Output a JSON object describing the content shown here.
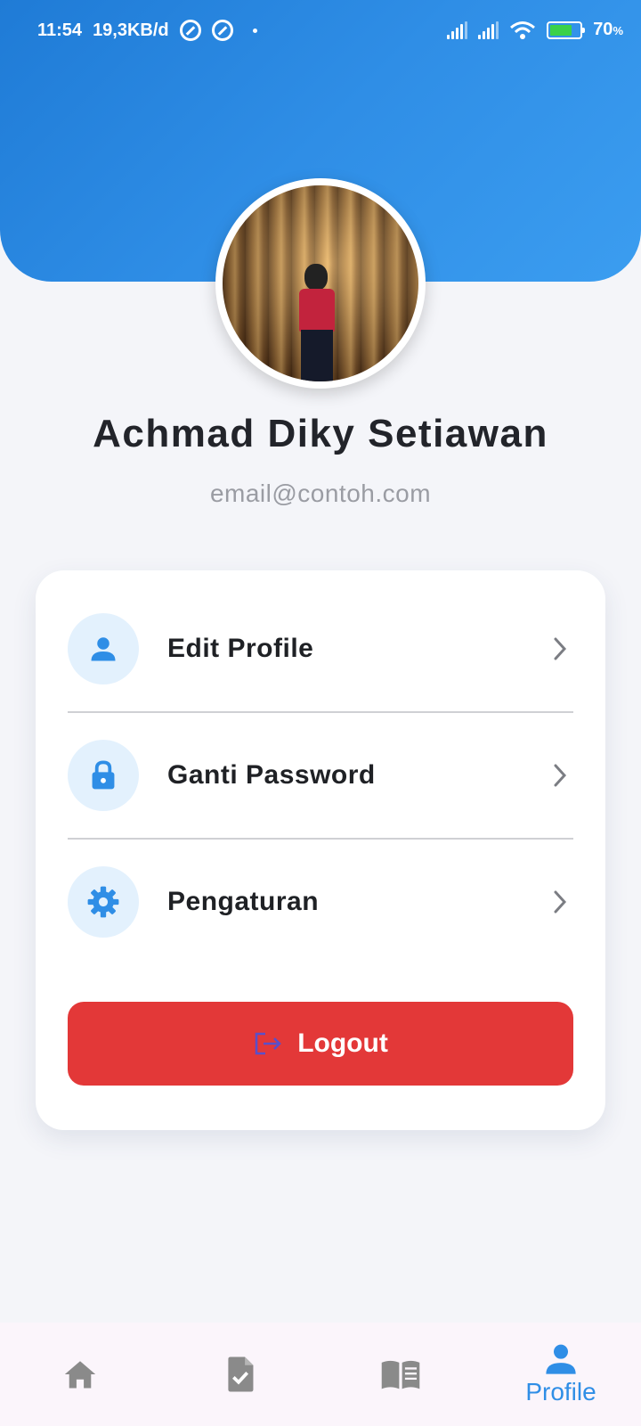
{
  "status_bar": {
    "time": "11:54",
    "network_speed": "19,3KB/d",
    "battery_percent": "70",
    "battery_suffix": "%"
  },
  "profile": {
    "name": "Achmad Diky Setiawan",
    "email": "email@contoh.com"
  },
  "menu": {
    "items": [
      {
        "label": "Edit Profile",
        "icon": "person-icon"
      },
      {
        "label": "Ganti Password",
        "icon": "lock-icon"
      },
      {
        "label": "Pengaturan",
        "icon": "gear-icon"
      }
    ],
    "logout_label": "Logout"
  },
  "bottom_nav": {
    "items": [
      {
        "icon": "home-icon",
        "label": ""
      },
      {
        "icon": "task-icon",
        "label": ""
      },
      {
        "icon": "book-icon",
        "label": ""
      },
      {
        "icon": "person-icon",
        "label": "Profile",
        "active": true
      }
    ]
  },
  "colors": {
    "header_gradient_start": "#1f7bd6",
    "header_gradient_end": "#3b9df0",
    "accent": "#2f8ee6",
    "logout": "#e33838",
    "icon_bg": "#e3f1fd",
    "nav_inactive": "#8a8a8a"
  }
}
